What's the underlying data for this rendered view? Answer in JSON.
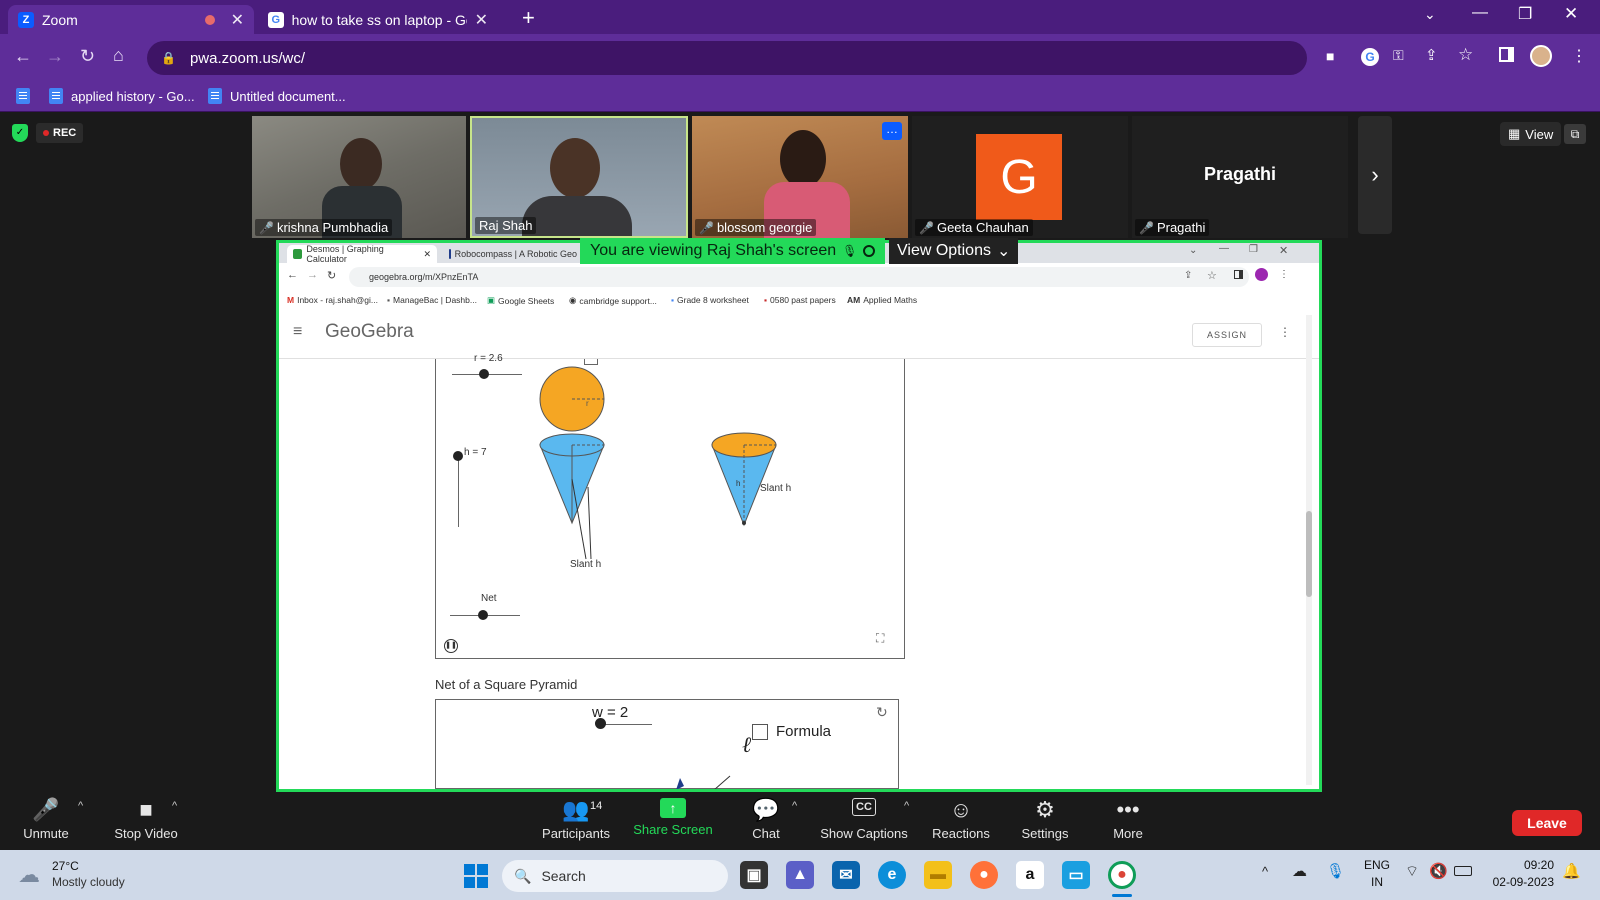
{
  "browser": {
    "tabs": [
      {
        "title": "Zoom",
        "icon": "zoom-icon"
      },
      {
        "title": "how to take ss on laptop - Googl",
        "icon": "google-icon"
      }
    ],
    "url": "pwa.zoom.us/wc/",
    "bookmarks": [
      "applied history - Go...",
      "Untitled document..."
    ]
  },
  "zoom": {
    "rec_label": "REC",
    "view_label": "View",
    "participants": [
      {
        "name": "krishna Pumbhadia",
        "muted": true
      },
      {
        "name": "Raj Shah",
        "muted": false
      },
      {
        "name": "blossom georgie",
        "muted": true
      },
      {
        "name": "Geeta Chauhan",
        "muted": true,
        "avatar_letter": "G"
      },
      {
        "name": "Pragathi",
        "muted": true,
        "display_name": "Pragathi"
      }
    ],
    "banner": "You are viewing Raj Shah's screen",
    "view_options": "View Options",
    "controls": {
      "unmute": "Unmute",
      "stop_video": "Stop Video",
      "participants": "Participants",
      "participants_count": "14",
      "share_screen": "Share Screen",
      "chat": "Chat",
      "show_captions": "Show Captions",
      "reactions": "Reactions",
      "settings": "Settings",
      "more": "More",
      "leave": "Leave"
    }
  },
  "shared": {
    "tabs": [
      "Desmos | Graphing Calculator",
      "Robocompass | A Robotic Geo"
    ],
    "url": "geogebra.org/m/XPnzEnTA",
    "bookmarks": [
      "Inbox - raj.shah@gi...",
      "ManageBac | Dashb...",
      "Google Sheets",
      "cambridge support...",
      "Grade 8 worksheet",
      "0580 past papers",
      "Applied Maths"
    ],
    "logo": "GeoGebra",
    "assign": "ASSIGN",
    "applet1": {
      "r_label": "r = 2.6",
      "h_label": "h = 7",
      "net_label": "Net",
      "slant_label_1": "Slant h",
      "slant_label_2": "Slant h",
      "r_small": "r",
      "h_small": "h"
    },
    "section_title": "Net of a Square Pyramid",
    "applet2": {
      "w_label": "w = 2",
      "formula_label": "Formula",
      "ell": "ℓ"
    }
  },
  "taskbar": {
    "weather_temp": "27°C",
    "weather_desc": "Mostly cloudy",
    "search": "Search",
    "lang1": "ENG",
    "lang2": "IN",
    "time": "09:20",
    "date": "02-09-2023"
  }
}
